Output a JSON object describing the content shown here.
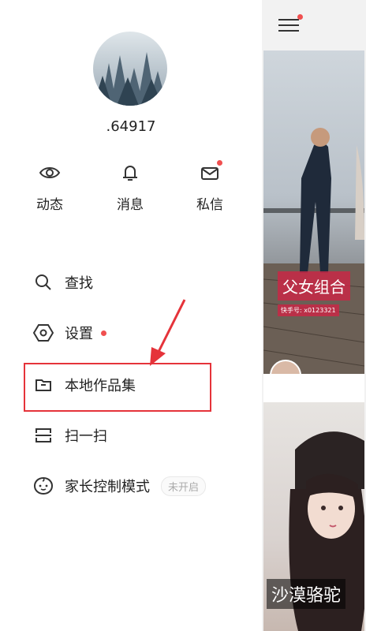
{
  "profile": {
    "username": ".64917"
  },
  "quick_actions": [
    {
      "label": "动态",
      "icon": "eye-icon"
    },
    {
      "label": "消息",
      "icon": "bell-icon"
    },
    {
      "label": "私信",
      "icon": "mail-icon"
    }
  ],
  "menu": [
    {
      "label": "查找",
      "icon": "search-icon"
    },
    {
      "label": "设置",
      "icon": "settings-hexagon-icon"
    },
    {
      "label": "本地作品集",
      "icon": "folder-icon"
    },
    {
      "label": "扫一扫",
      "icon": "scan-icon"
    },
    {
      "label": "家长控制模式",
      "icon": "child-face-icon",
      "badge": "未开启"
    }
  ],
  "feed": [
    {
      "title": "父女组合",
      "sub": "快手号: x0123321"
    },
    {
      "title": "沙漠骆驼"
    }
  ],
  "colors": {
    "accent": "#e5333a",
    "dot": "#f04f4f"
  }
}
